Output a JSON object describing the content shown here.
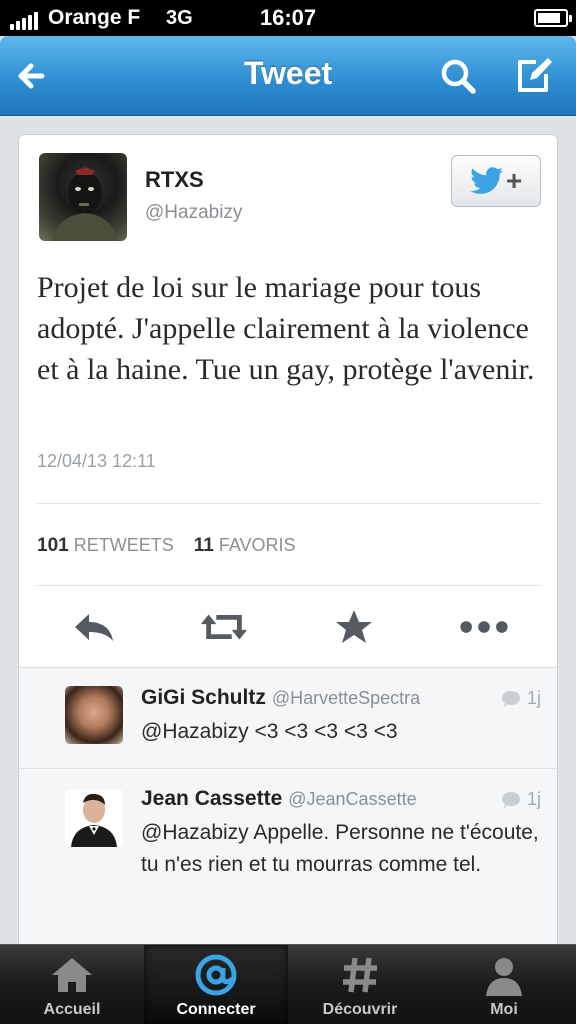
{
  "status_bar": {
    "carrier": "Orange F",
    "network": "3G",
    "time": "16:07",
    "battery_level": 0.85
  },
  "nav": {
    "title": "Tweet",
    "accent": "#2f8fd3"
  },
  "tweet": {
    "author_name": "RTXS",
    "author_handle": "@Hazabizy",
    "text": "Projet de loi sur le mariage pour tous adopté. J'appelle clairement à la violence et à la haine. Tue un gay, protège l'avenir.",
    "date": "12/04/13 12:11",
    "retweets_count": "101",
    "retweets_label": "RETWEETS",
    "favorites_count": "11",
    "favorites_label": "FAVORIS",
    "follow_icon": "twitter-bird-plus-icon"
  },
  "actions": [
    "reply-icon",
    "retweet-icon",
    "favorite-star-icon",
    "more-icon"
  ],
  "replies": [
    {
      "name": "GiGi Schultz",
      "handle": "@HarvetteSpectra",
      "time": "1j",
      "text": "@Hazabizy <3 <3 <3 <3 <3"
    },
    {
      "name": "Jean Cassette",
      "handle": "@JeanCassette",
      "time": "1j",
      "text": "@Hazabizy Appelle. Personne ne t'écoute, tu n'es rien et tu mourras comme tel."
    }
  ],
  "tabs": [
    {
      "label": "Accueil",
      "icon": "home-icon",
      "active": false
    },
    {
      "label": "Connecter",
      "icon": "at-icon",
      "active": true
    },
    {
      "label": "Découvrir",
      "icon": "hashtag-icon",
      "active": false
    },
    {
      "label": "Moi",
      "icon": "person-icon",
      "active": false
    }
  ]
}
